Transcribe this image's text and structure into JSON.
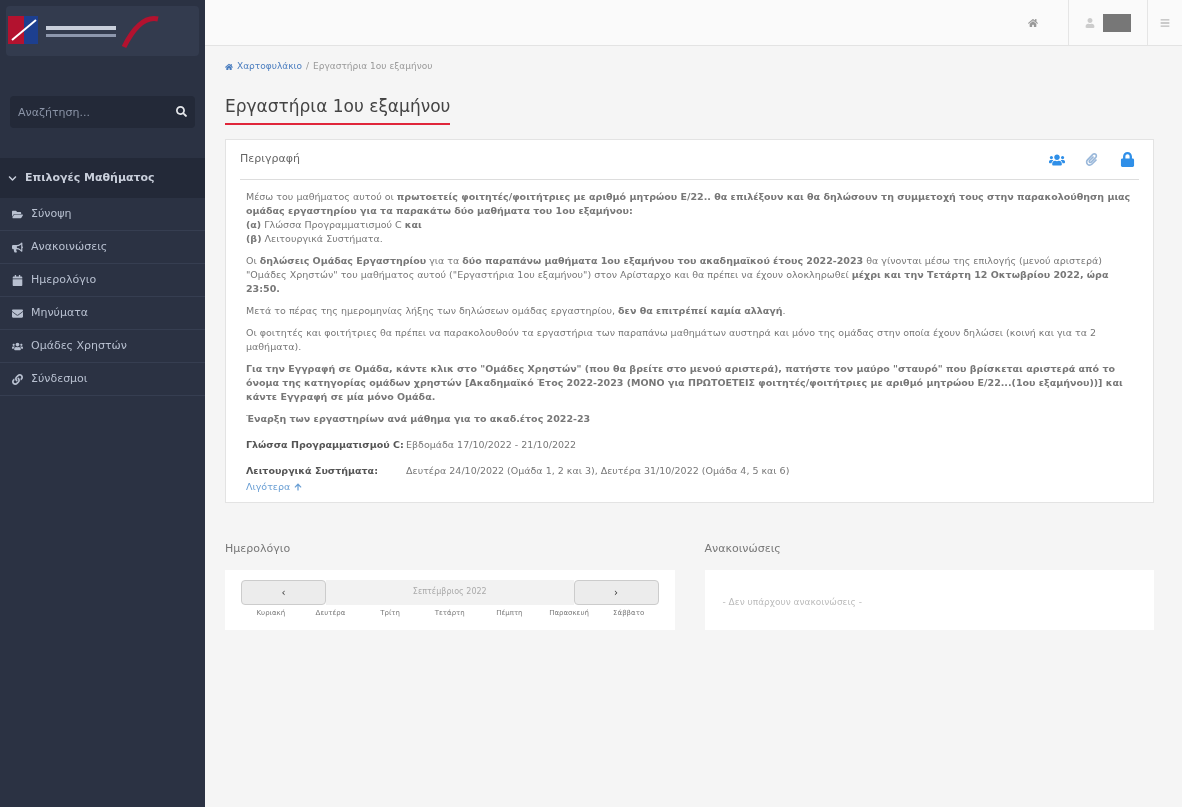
{
  "sidebar": {
    "search": {
      "placeholder": "Αναζήτηση..."
    },
    "menu": {
      "title": "Επιλογές Μαθήματος",
      "expanded": true,
      "items": [
        {
          "label": "Σύνοψη"
        },
        {
          "label": "Ανακοινώσεις"
        },
        {
          "label": "Ημερολόγιο"
        },
        {
          "label": "Μηνύματα"
        },
        {
          "label": "Ομάδες Χρηστών"
        },
        {
          "label": "Σύνδεσμοι"
        }
      ]
    }
  },
  "breadcrumb": {
    "separator": "/",
    "items": [
      "Χαρτοφυλάκιο",
      "Εργαστήρια 1ου εξαμήνου"
    ]
  },
  "page_title": "Εργαστήρια 1ου εξαμήνου",
  "description": {
    "title": "Περιγραφή",
    "paragraphs": [
      "Μέσω του μαθήματος αυτού οι **πρωτοετείς φοιτητές/φοιτήτριες με αριθμό μητρώου Ε/22.. θα επιλέξουν και θα δηλώσουν τη συμμετοχή τους στην παρακολούθηση μιας ομάδας εργαστηρίου για τα παρακάτω δύο μαθήματα του 1ου εξαμήνου:**",
      "**(α)** Γλώσσα Προγραμματισμού C **και**",
      "**(β)** Λειτουργικά Συστήματα.",
      "Οι **δηλώσεις Ομάδας Εργαστηρίου** για τα **δύο παραπάνω μαθήματα 1ου εξαμήνου του ακαδημαϊκού έτους 2022-2023** θα γίνονται μέσω της επιλογής (μενού αριστερά) \"Ομάδες Χρηστών\" του μαθήματος αυτού (\"Εργαστήρια 1ου εξαμήνου\") στον Αρίσταρχο και θα πρέπει να έχουν ολοκληρωθεί **μέχρι και την Τετάρτη 12 Οκτωβρίου 2022, ώρα 23:50.**",
      "Μετά το πέρας της ημερομηνίας λήξης των δηλώσεων ομάδας εργαστηρίου, **δεν θα επιτρέπεί καμία αλλαγή**.",
      "Οι φοιτητές και φοιτήτριες θα πρέπει να παρακολουθούν τα εργαστήρια των παραπάνω μαθημάτων αυστηρά και μόνο της ομάδας στην οποία έχουν δηλώσει (κοινή και για τα 2 μαθήματα).",
      "**Για την Εγγραφή σε Ομάδα, κάντε κλικ στο \"Ομάδες Χρηστών\" (που θα βρείτε στο μενού αριστερά), πατήστε τον μαύρο \"σταυρό\" που βρίσκεται αριστερά από το όνομα της κατηγορίας ομάδων χρηστών [Ακαδημαϊκό Έτος 2022-2023 (ΜΟΝΟ για ΠΡΩΤΟΕΤΕΙΣ φοιτητές/φοιτήτριες με αριθμό μητρώου Ε/22...(1ου εξαμήνου))] και κάντε Εγγραφή σε μία μόνο Ομάδα.**",
      "**Έναρξη των εργαστηρίων ανά μάθημα για το ακαδ.έτος 2022-23**"
    ],
    "schedule": [
      {
        "course": "Γλώσσα Προγραμματισμού C:",
        "dates": "Εβδομάδα 17/10/2022 - 21/10/2022"
      },
      {
        "course": "Λειτουργικά Συστήματα:",
        "dates": "Δευτέρα 24/10/2022 (Ομάδα 1, 2 και 3), Δευτέρα 31/10/2022 (Ομάδα 4, 5 και 6)"
      }
    ],
    "less_link": "Λιγότερα"
  },
  "calendar": {
    "title": "Ημερολόγιο",
    "prev": "‹",
    "next": "›",
    "month": "Σεπτέμβριος 2022",
    "weekdays": [
      "Κυριακή",
      "Δευτέρα",
      "Τρίτη",
      "Τετάρτη",
      "Πέμπτη",
      "Παρασκευή",
      "Σάββατο"
    ]
  },
  "announcements": {
    "title": "Ανακοινώσεις",
    "empty": "- Δεν υπάρχουν ανακοινώσεις -"
  }
}
